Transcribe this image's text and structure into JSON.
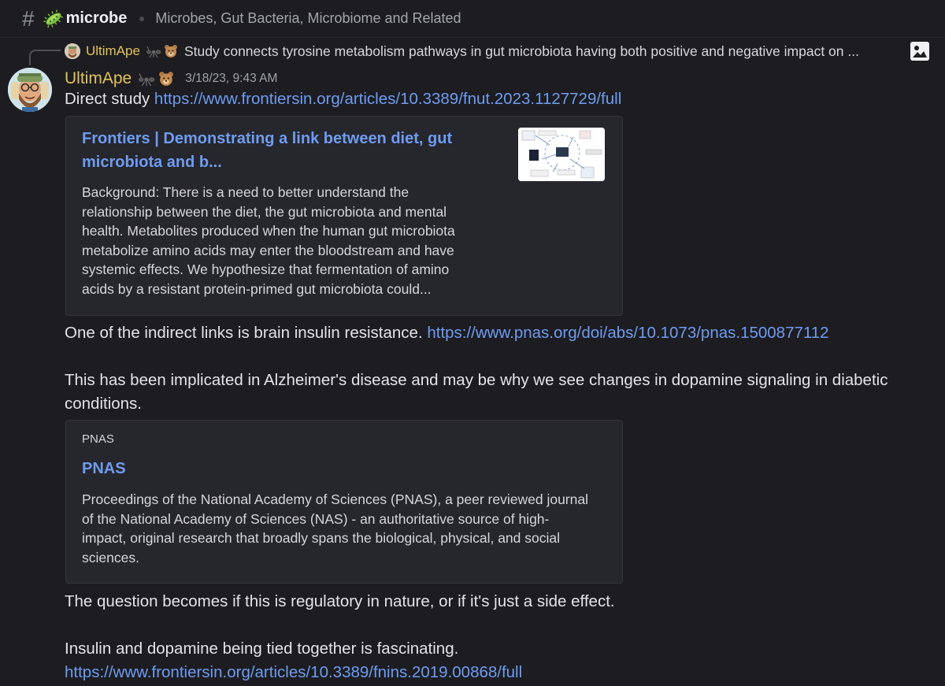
{
  "header": {
    "hash": "#",
    "channel": "microbe",
    "topic": "Microbes, Gut Bacteria, Microbiome and Related"
  },
  "reply": {
    "author": "UltimApe",
    "text": "Study connects tyrosine metabolism pathways in gut microbiota having both positive and negative impact on ..."
  },
  "message": {
    "author": "UltimApe",
    "timestamp": "3/18/23, 9:43 AM",
    "line1_prefix": "Direct study ",
    "line1_link": "https://www.frontiersin.org/articles/10.3389/fnut.2023.1127729/full",
    "embed1": {
      "title_line1": "Frontiers | Demonstrating a link between diet, gut",
      "title_line2": "microbiota and b...",
      "desc": [
        "Background: There is a need to better understand the",
        "relationship between the diet, the gut microbiota and mental",
        "health. Metabolites produced when the human gut microbiota",
        "metabolize amino acids may enter the bloodstream and have",
        "systemic effects. We hypothesize that fermentation of amino",
        "acids by a resistant protein-primed gut microbiota could..."
      ]
    },
    "line2_prefix": "One of the indirect links is brain insulin resistance. ",
    "line2_link": "https://www.pnas.org/doi/abs/10.1073/pnas.1500877112",
    "line3a": "This has been implicated in Alzheimer's disease and may be why we see changes in dopamine signaling in diabetic",
    "line3b": "conditions.",
    "embed2": {
      "provider": "PNAS",
      "title": "PNAS",
      "desc": [
        "Proceedings of the National Academy of Sciences (PNAS), a peer reviewed journal",
        "of the National Academy of Sciences (NAS) - an authoritative source of high-",
        "impact, original research that broadly spans the biological, physical, and social",
        "sciences."
      ]
    },
    "line4": "The question becomes if this is regulatory in nature, or if it's just a side effect.",
    "line5": "Insulin and dopamine being tied together is fascinating.",
    "line6_link": "https://www.frontiersin.org/articles/10.3389/fnins.2019.00868/full"
  },
  "icons": {
    "channel": "hash-icon",
    "channel_emoji": "microbe-icon",
    "badges": [
      "ant-icon",
      "bear-icon"
    ],
    "attachment": "image-icon"
  },
  "colors": {
    "background": "#1c1c21",
    "username": "#e2c35a",
    "link": "#6f9cf0",
    "embed_bg": "#26262d"
  }
}
